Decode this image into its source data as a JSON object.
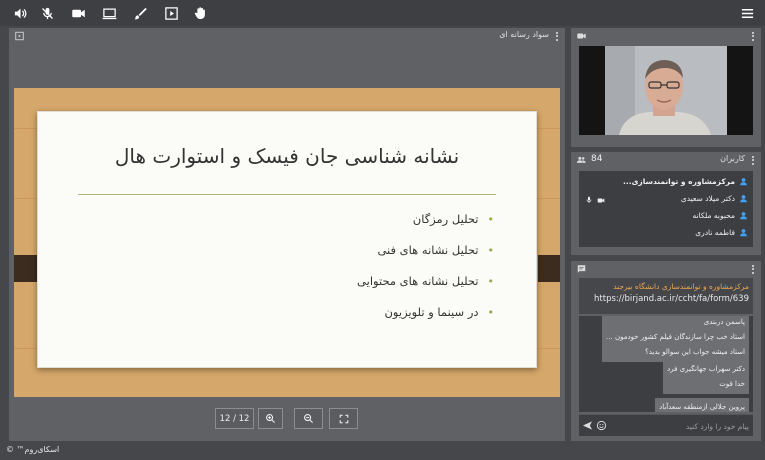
{
  "toolbar": {
    "icons": [
      "speaker-icon",
      "mic-off-icon",
      "camera-icon",
      "screen-share-icon",
      "brush-icon",
      "play-media-icon",
      "raise-hand-icon",
      "hamburger-menu-icon"
    ]
  },
  "media_panel": {
    "title": "سواد رسانه ای",
    "slide": {
      "title": "نشانه شناسی جان فیسک و استوارت هال",
      "bullets": [
        "تحلیل رمزگان",
        "تحلیل نشانه های فنی",
        "تحلیل نشانه های محتوایی",
        "در سینما و تلویزیون"
      ]
    },
    "page_indicator": "12 / 12"
  },
  "users_panel": {
    "title": "کاربران",
    "count": "84",
    "users": [
      {
        "name": "مرکزمشاوره و توانمندسازی...",
        "bold": true,
        "mic": true,
        "cam": true
      },
      {
        "name": "دکتر میلاد سعیدی",
        "bold": false,
        "mic": false,
        "cam": false
      },
      {
        "name": "محبوبه ملکانه",
        "bold": false,
        "mic": false,
        "cam": false
      },
      {
        "name": "فاطمه نادری",
        "bold": false,
        "mic": false,
        "cam": false
      }
    ]
  },
  "chat_panel": {
    "pinned_title": "مرکزمشاوره و توانمندسازی دانشگاه بیرجند",
    "pinned_link": "https://birjand.ac.ir/ccht/fa/form/639",
    "messages": [
      {
        "lines": [
          "پاسمن دربندی",
          "استاد خب چرا سازندگان فیلم کشور خودمون ...",
          "استاد میشه جواب این سوالو بدید؟"
        ]
      },
      {
        "lines": [
          "دکتر سهراب جهانگیری فرد",
          "خدا قوت"
        ]
      },
      {
        "lines": [
          "پروین جلالی ازمنطقه سعدآباد"
        ]
      }
    ],
    "input_placeholder": "پیام خود را وارد کنید"
  },
  "footer": {
    "brand": "اسکای‌روم™ ©"
  },
  "colors": {
    "pinned_accent": "#f0a74f",
    "user_icon": "#3fa2f7",
    "slide_bullet": "#9aa64a"
  }
}
